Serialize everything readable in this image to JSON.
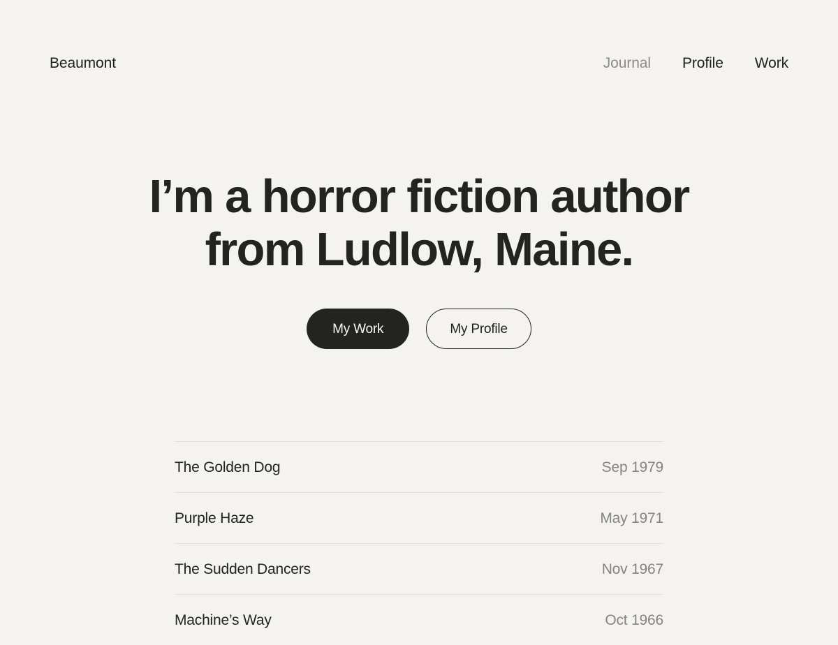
{
  "header": {
    "brand": "Beaumont",
    "nav": [
      {
        "label": "Journal",
        "muted": true
      },
      {
        "label": "Profile",
        "muted": false
      },
      {
        "label": "Work",
        "muted": false
      }
    ]
  },
  "hero": {
    "title_line_1": "I’m a horror fiction author",
    "title_line_2": "from Ludlow, Maine.",
    "primary_button": "My Work",
    "secondary_button": "My Profile"
  },
  "works": [
    {
      "title": "The Golden Dog",
      "date": "Sep 1979"
    },
    {
      "title": "Purple Haze",
      "date": "May 1971"
    },
    {
      "title": "The Sudden Dancers",
      "date": "Nov 1967"
    },
    {
      "title": "Machine’s Way",
      "date": "Oct 1966"
    }
  ],
  "colors": {
    "background": "#f4f3f0",
    "text": "#232321",
    "muted_text": "#85847f",
    "accent_dark": "#23231f",
    "divider": "#e2e0dc"
  }
}
